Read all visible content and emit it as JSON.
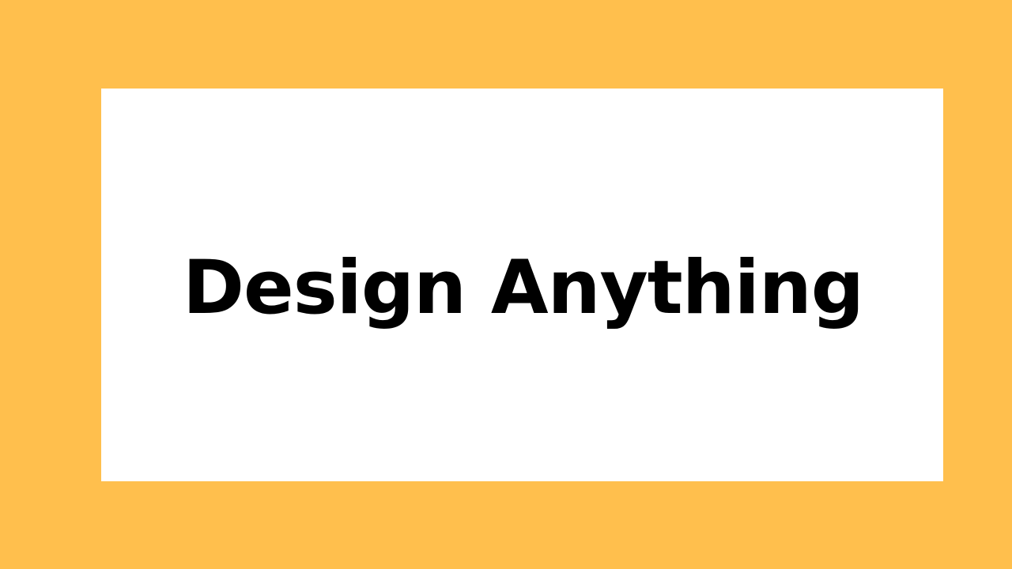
{
  "slide": {
    "headline": "Design Anything"
  },
  "colors": {
    "background": "#FFBF4D",
    "card": "#FFFFFF",
    "text": "#000000"
  }
}
